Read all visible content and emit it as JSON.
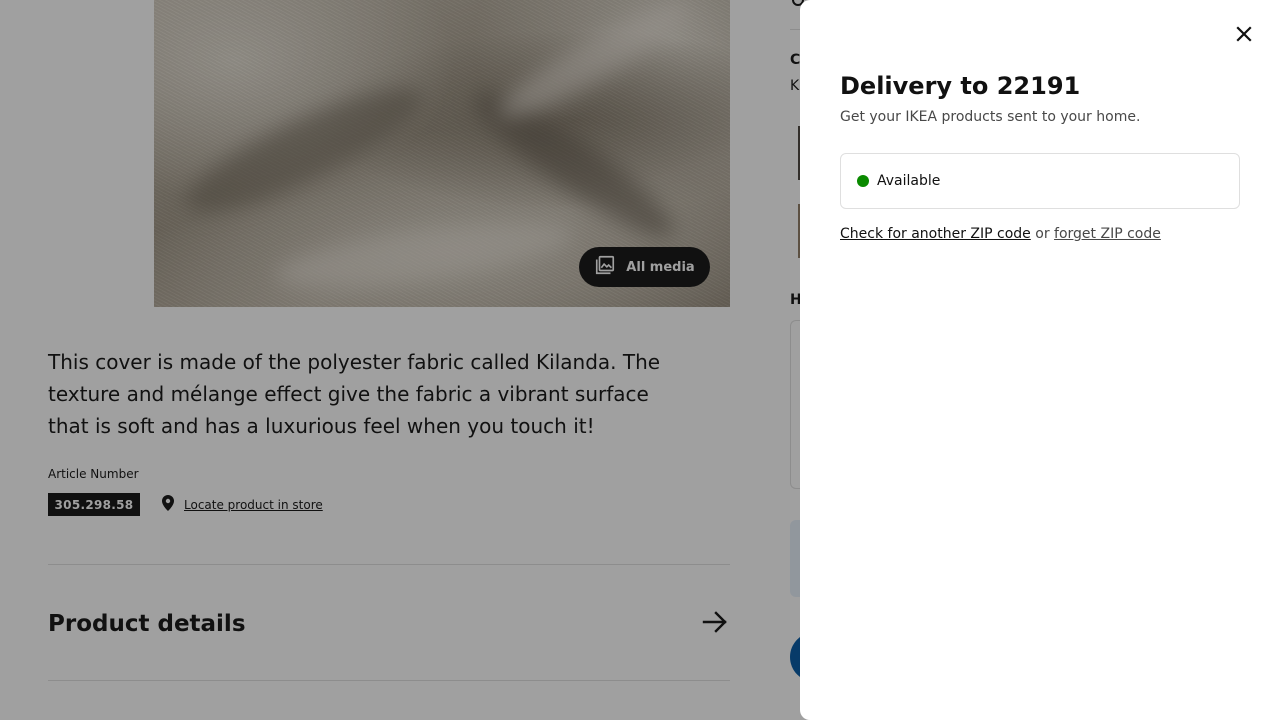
{
  "product": {
    "all_media_label": "All media",
    "description": "This cover is made of the polyester fabric called Kilanda. The texture and mélange effect give the fabric a vibrant surface that is soft and has a luxurious feel when you touch it!",
    "article_number_label": "Article Number",
    "article_number": "305.298.58",
    "locate_link": "Locate product in store",
    "product_details_title": "Product details"
  },
  "peek": {
    "letter_c": "C",
    "letter_k": "K",
    "letter_h": "H"
  },
  "drawer": {
    "title": "Delivery to 22191",
    "subtitle": "Get your IKEA products sent to your home.",
    "status": "Available",
    "status_color": "#0a8a00",
    "check_zip_link": "Check for another ZIP code",
    "or_text": "or",
    "forget_zip_link": "forget ZIP code"
  }
}
